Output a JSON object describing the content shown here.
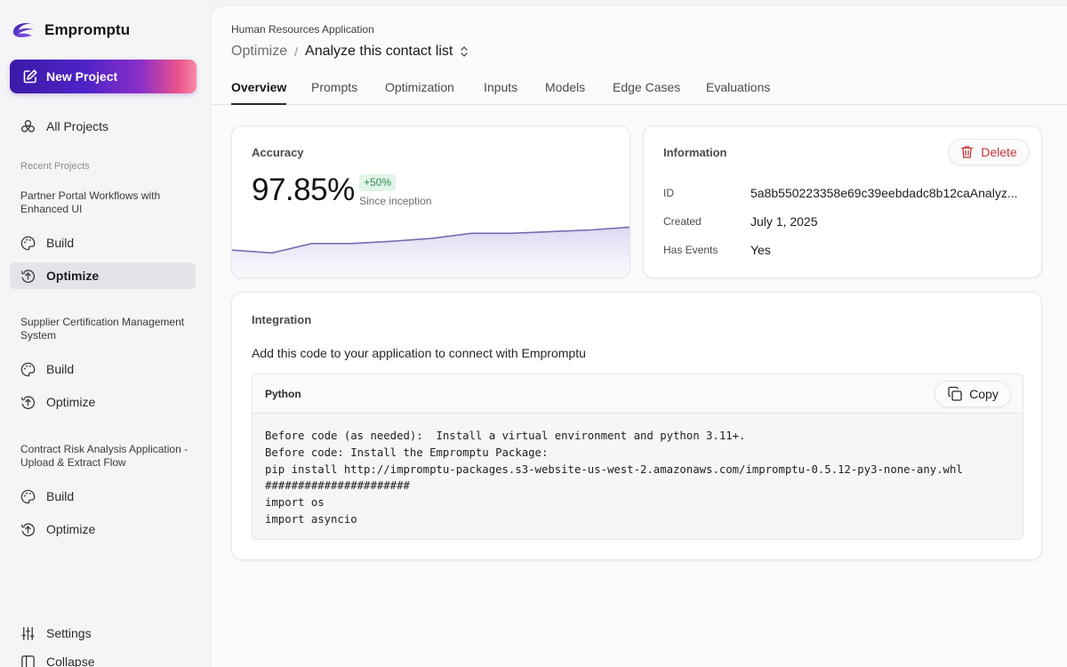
{
  "brand": {
    "name": "Empromptu",
    "logo_icon": "empromptu-logo-icon"
  },
  "sidebar": {
    "new_project_label": "New Project",
    "all_projects_label": "All Projects",
    "recent_projects_label": "Recent Projects",
    "projects": [
      {
        "title": "Partner Portal Workflows with Enhanced UI",
        "build_label": "Build",
        "optimize_label": "Optimize",
        "active": "optimize"
      },
      {
        "title": "Supplier Certification Management System",
        "build_label": "Build",
        "optimize_label": "Optimize",
        "active": null
      },
      {
        "title": "Contract Risk Analysis Application - Upload & Extract Flow",
        "build_label": "Build",
        "optimize_label": "Optimize",
        "active": null
      }
    ],
    "settings_label": "Settings",
    "collapse_label": "Collapse"
  },
  "header": {
    "app_name": "Human Resources Application",
    "breadcrumb_parent": "Optimize",
    "breadcrumb_separator": "/",
    "breadcrumb_current": "Analyze this contact list"
  },
  "tabs": [
    "Overview",
    "Prompts",
    "Optimization",
    "Inputs",
    "Models",
    "Edge Cases",
    "Evaluations"
  ],
  "active_tab": "Overview",
  "accuracy": {
    "title": "Accuracy",
    "value": "97.85%",
    "change": "+50%",
    "since": "Since inception",
    "trend": [
      0.15,
      0.05,
      0.38,
      0.38,
      0.46,
      0.56,
      0.74,
      0.74,
      0.8,
      0.86,
      0.96
    ],
    "line_color": "#7a6bb0"
  },
  "information": {
    "title": "Information",
    "delete_label": "Delete",
    "id_label": "ID",
    "id_value": "5a8b550223358e69c39eebdadc8b12caAnalyz...",
    "created_label": "Created",
    "created_value": "July 1, 2025",
    "has_events_label": "Has Events",
    "has_events_value": "Yes"
  },
  "integration": {
    "title": "Integration",
    "description": "Add this code to your application to connect with Empromptu",
    "language": "Python",
    "copy_label": "Copy",
    "code_lines": [
      "Before code (as needed):  Install a virtual environment and python 3.11+.",
      "Before code: Install the Empromptu Package:",
      "pip install http://impromptu-packages.s3-website-us-west-2.amazonaws.com/impromptu-0.5.12-py3-none-any.whl",
      "######################",
      "import os",
      "import asyncio"
    ]
  },
  "colors": {
    "accent": "#4e23c6",
    "delete": "#c5363a",
    "positive": "#2d8a4e"
  }
}
